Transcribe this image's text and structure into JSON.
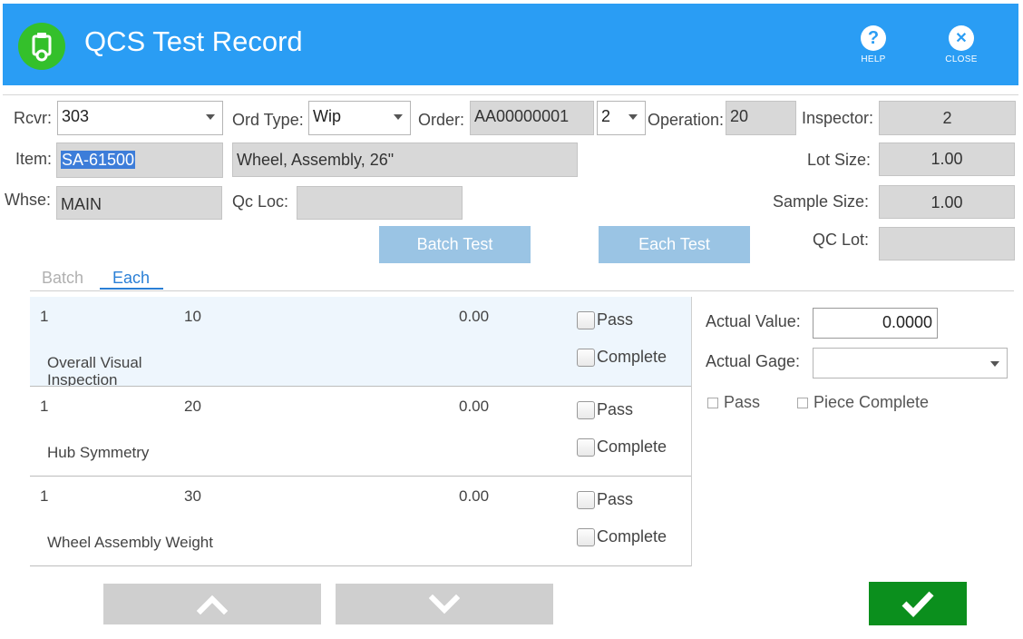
{
  "header": {
    "title": "QCS Test Record",
    "help_label": "HELP",
    "close_label": "CLOSE",
    "help_glyph": "?",
    "close_glyph": "✕"
  },
  "form": {
    "rcvr_label": "Rcvr:",
    "rcvr_value": "303",
    "ord_type_label": "Ord Type:",
    "ord_type_value": "Wip",
    "order_label": "Order:",
    "order_value": "AA00000001",
    "order_suffix_value": "2",
    "operation_label": "Operation:",
    "operation_value": "20",
    "inspector_label": "Inspector:",
    "inspector_value": "2",
    "item_label": "Item:",
    "item_value": "SA-61500",
    "item_description": "Wheel, Assembly, 26\"",
    "lot_size_label": "Lot Size:",
    "lot_size_value": "1.00",
    "whse_label": "Whse:",
    "whse_value": "MAIN",
    "qc_loc_label": "Qc Loc:",
    "qc_loc_value": "",
    "sample_size_label": "Sample Size:",
    "sample_size_value": "1.00",
    "qc_lot_label": "QC Lot:",
    "qc_lot_value": ""
  },
  "actions": {
    "batch_test_label": "Batch Test",
    "each_test_label": "Each Test"
  },
  "tabs": {
    "batch": "Batch",
    "each": "Each",
    "active": "Each"
  },
  "tests": [
    {
      "seq": "1",
      "step": "10",
      "value": "0.00",
      "pass_label": "Pass",
      "complete_label": "Complete",
      "description": "Overall Visual Inspection",
      "pass": false,
      "complete": false,
      "selected": true
    },
    {
      "seq": "1",
      "step": "20",
      "value": "0.00",
      "pass_label": "Pass",
      "complete_label": "Complete",
      "description": "Hub Symmetry",
      "pass": false,
      "complete": false,
      "selected": false
    },
    {
      "seq": "1",
      "step": "30",
      "value": "0.00",
      "pass_label": "Pass",
      "complete_label": "Complete",
      "description": "Wheel Assembly Weight",
      "pass": false,
      "complete": false,
      "selected": false
    }
  ],
  "detail": {
    "actual_value_label": "Actual Value:",
    "actual_value": "0.0000",
    "actual_gage_label": "Actual Gage:",
    "actual_gage_value": "",
    "pass_label": "Pass",
    "piece_complete_label": "Piece Complete"
  },
  "colors": {
    "header_bg": "#2a9df4",
    "app_icon_bg": "#34c02b",
    "confirm_bg": "#0b8f1d",
    "accent": "#2a7fd6"
  }
}
